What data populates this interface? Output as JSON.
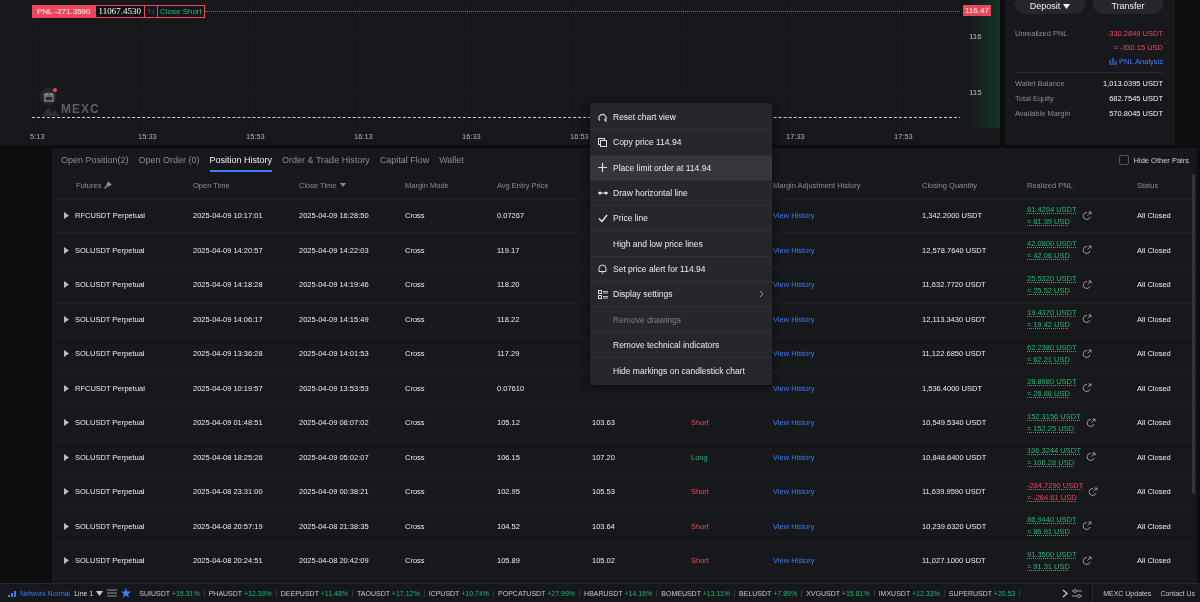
{
  "chart": {
    "position_tag": {
      "pnl": "PNL -271.3590",
      "price": "11067.4530",
      "swap": "↑↓",
      "action": "Close Short"
    },
    "price_tag": "116.47",
    "price_labels": [
      "116",
      "115"
    ],
    "time_labels": [
      "5:13",
      "15:33",
      "15:53",
      "16:13",
      "16:33",
      "16:53",
      "17:33",
      "17:53"
    ],
    "watermark": "MEXC"
  },
  "account": {
    "buttons": [
      {
        "label": "Deposit",
        "dropdown": true
      },
      {
        "label": "Transfer",
        "dropdown": false
      }
    ],
    "unrealized_label": "Unrealized PNL",
    "unrealized_usdt": "-330.2849 USDT",
    "unrealized_usd": "≈ -330.15 USD",
    "pnl_analysis": "PNL Analysis",
    "rows": [
      {
        "label": "Wallet Balance",
        "value": "1,013.0395 USDT"
      },
      {
        "label": "Total Equity",
        "value": "682.7545 USDT"
      },
      {
        "label": "Available Margin",
        "value": "570.8045 USDT"
      }
    ]
  },
  "tabs": [
    {
      "label": "Open Position(2)",
      "selected": false
    },
    {
      "label": "Open Order (0)",
      "selected": false
    },
    {
      "label": "Position History",
      "selected": true
    },
    {
      "label": "Order & Trade History",
      "selected": false
    },
    {
      "label": "Capital Flow",
      "selected": false
    },
    {
      "label": "Wallet",
      "selected": false
    }
  ],
  "hide_other_pairs": {
    "label": "Hide Other Pairs",
    "checked": false
  },
  "table": {
    "columns": [
      {
        "label": "Futures",
        "kind": "pin"
      },
      {
        "label": "Open Time",
        "kind": "plain"
      },
      {
        "label": "Close Time",
        "kind": "sort"
      },
      {
        "label": "Margin Mode",
        "kind": "plain"
      },
      {
        "label": "Avg Entry Price",
        "kind": "plain"
      },
      {
        "label": "Margin Adjustment History",
        "kind": "plain"
      },
      {
        "label": "Closing Quantity",
        "kind": "plain"
      },
      {
        "label": "Realized PNL",
        "kind": "plain"
      },
      {
        "label": "Status",
        "kind": "plain"
      }
    ],
    "rows": [
      {
        "pair": "RFCUSDT Perpetual",
        "open_time": "2025-04-09 10:17:01",
        "close_time": "2025-04-09 16:28:50",
        "margin_mode": "Cross",
        "avg_entry": "0.07267",
        "margin_adjustment": "View History",
        "closing_quantity": "1,342.2000 USDT",
        "pnl": {
          "usdt": "81.4294 USDT",
          "usd": "≈ 81.39 USD",
          "kind": "gain"
        },
        "status": "All Closed"
      },
      {
        "pair": "SOLUSDT Perpetual",
        "open_time": "2025-04-09 14:20:57",
        "close_time": "2025-04-09 14:22:03",
        "margin_mode": "Cross",
        "avg_entry": "119.17",
        "margin_adjustment": "View History",
        "closing_quantity": "12,578.7640 USDT",
        "pnl": {
          "usdt": "42.0800 USDT",
          "usd": "≈ 42.06 USD",
          "kind": "gain"
        },
        "status": "All Closed"
      },
      {
        "pair": "SOLUSDT Perpetual",
        "open_time": "2025-04-09 14:18:28",
        "close_time": "2025-04-09 14:19:46",
        "margin_mode": "Cross",
        "avg_entry": "118.20",
        "margin_adjustment": "View History",
        "closing_quantity": "11,632.7720 USDT",
        "pnl": {
          "usdt": "25.5320 USDT",
          "usd": "≈ 25.52 USD",
          "kind": "gain"
        },
        "status": "All Closed"
      },
      {
        "pair": "SOLUSDT Perpetual",
        "open_time": "2025-04-09 14:06:17",
        "close_time": "2025-04-09 14:15:49",
        "margin_mode": "Cross",
        "avg_entry": "118.22",
        "margin_adjustment": "View History",
        "closing_quantity": "12,113.3430 USDT",
        "pnl": {
          "usdt": "19.4370 USDT",
          "usd": "≈ 19.42 USD",
          "kind": "gain"
        },
        "status": "All Closed"
      },
      {
        "pair": "SOLUSDT Perpetual",
        "open_time": "2025-04-09 13:36:28",
        "close_time": "2025-04-09 14:01:53",
        "margin_mode": "Cross",
        "avg_entry": "117.29",
        "margin_adjustment": "View History",
        "closing_quantity": "11,122.6850 USDT",
        "pnl": {
          "usdt": "62.2380 USDT",
          "usd": "≈ 62.21 USD",
          "kind": "gain"
        },
        "status": "All Closed"
      },
      {
        "pair": "RFCUSDT Perpetual",
        "open_time": "2025-04-09 10:19:57",
        "close_time": "2025-04-09 13:53:53",
        "margin_mode": "Cross",
        "avg_entry": "0.07610",
        "margin_adjustment": "View History",
        "closing_quantity": "1,536.4000 USDT",
        "pnl": {
          "usdt": "28.8980 USDT",
          "usd": "≈ 28.88 USD",
          "kind": "gain"
        },
        "status": "All Closed"
      },
      {
        "pair": "SOLUSDT Perpetual",
        "open_time": "2025-04-09 01:48:51",
        "close_time": "2025-04-09 08:07:02",
        "margin_mode": "Cross",
        "avg_entry": "105.12",
        "avg_close": "103.63",
        "direction": {
          "text": "Short",
          "kind": "short"
        },
        "margin_adjustment": "View History",
        "closing_quantity": "10,549.5340 USDT",
        "pnl": {
          "usdt": "152.3156 USDT",
          "usd": "≈ 152.25 USD",
          "kind": "gain"
        },
        "status": "All Closed"
      },
      {
        "pair": "SOLUSDT Perpetual",
        "open_time": "2025-04-08 18:25:26",
        "close_time": "2025-04-09 05:02:07",
        "margin_mode": "Cross",
        "avg_entry": "106.15",
        "avg_close": "107.20",
        "direction": {
          "text": "Long",
          "kind": "long"
        },
        "margin_adjustment": "View History",
        "closing_quantity": "10,848.6400 USDT",
        "pnl": {
          "usdt": "106.3244 USDT",
          "usd": "≈ 106.28 USD",
          "kind": "gain"
        },
        "status": "All Closed"
      },
      {
        "pair": "SOLUSDT Perpetual",
        "open_time": "2025-04-08 23:31:00",
        "close_time": "2025-04-09 00:38:21",
        "margin_mode": "Cross",
        "avg_entry": "102.95",
        "avg_close": "105.53",
        "direction": {
          "text": "Short",
          "kind": "short"
        },
        "margin_adjustment": "View History",
        "closing_quantity": "11,639.9590 USDT",
        "pnl": {
          "usdt": "-284.7290 USDT",
          "usd": "≈ -284.61 USD",
          "kind": "loss"
        },
        "status": "All Closed"
      },
      {
        "pair": "SOLUSDT Perpetual",
        "open_time": "2025-04-08 20:57:19",
        "close_time": "2025-04-08 21:38:35",
        "margin_mode": "Cross",
        "avg_entry": "104.52",
        "avg_close": "103.64",
        "direction": {
          "text": "Short",
          "kind": "short"
        },
        "margin_adjustment": "View History",
        "closing_quantity": "10,239.6320 USDT",
        "pnl": {
          "usdt": "86.9440 USDT",
          "usd": "≈ 86.91 USD",
          "kind": "gain"
        },
        "status": "All Closed"
      },
      {
        "pair": "SOLUSDT Perpetual",
        "open_time": "2025-04-08 20:24:51",
        "close_time": "2025-04-08 20:42:09",
        "margin_mode": "Cross",
        "avg_entry": "105.89",
        "avg_close": "105.02",
        "direction": {
          "text": "Short",
          "kind": "short"
        },
        "margin_adjustment": "View History",
        "closing_quantity": "11,027.1000 USDT",
        "pnl": {
          "usdt": "91.3500 USDT",
          "usd": "≈ 91.31 USD",
          "kind": "gain"
        },
        "status": "All Closed"
      }
    ]
  },
  "context_menu": [
    {
      "label": "Reset chart view",
      "kind": "reset",
      "checked": false,
      "disabled": false,
      "highlighted": false,
      "submenu": false
    },
    {
      "label": "Copy price 114.94",
      "kind": "copy",
      "checked": false,
      "disabled": false,
      "highlighted": false,
      "submenu": false
    },
    {
      "label": "Place limit order at 114.94",
      "kind": "plus",
      "checked": false,
      "disabled": false,
      "highlighted": true,
      "submenu": false
    },
    {
      "label": "Draw horizontal line",
      "kind": "hline",
      "checked": false,
      "disabled": false,
      "highlighted": false,
      "submenu": false
    },
    {
      "label": "Price line",
      "kind": "plain",
      "checked": true,
      "disabled": false,
      "highlighted": false,
      "submenu": false
    },
    {
      "label": "High and low price lines",
      "kind": "plain",
      "checked": false,
      "disabled": false,
      "highlighted": false,
      "submenu": false
    },
    {
      "label": "Set price alert for 114.94",
      "kind": "bell",
      "checked": false,
      "disabled": false,
      "highlighted": false,
      "submenu": false
    },
    {
      "label": "Display settings",
      "kind": "settings",
      "checked": false,
      "disabled": false,
      "highlighted": false,
      "submenu": true
    },
    {
      "label": "Remove drawings",
      "kind": "plain",
      "checked": false,
      "disabled": true,
      "highlighted": false,
      "submenu": false
    },
    {
      "label": "Remove technical indicators",
      "kind": "plain",
      "checked": false,
      "disabled": false,
      "highlighted": false,
      "submenu": false
    },
    {
      "label": "Hide markings on candlestick chart",
      "kind": "plain",
      "checked": false,
      "disabled": false,
      "highlighted": false,
      "submenu": false
    }
  ],
  "status_bar": {
    "network": "Network Normal",
    "line": "Line 1",
    "tickers": [
      {
        "symbol": "SUIUSDT",
        "change": "+15.31%"
      },
      {
        "symbol": "PHAUSDT",
        "change": "+12.39%"
      },
      {
        "symbol": "DEEPUSDT",
        "change": "+11.48%"
      },
      {
        "symbol": "TAOUSDT",
        "change": "+17.12%"
      },
      {
        "symbol": "ICPUSDT",
        "change": "+10.74%"
      },
      {
        "symbol": "POPCATUSDT",
        "change": "+27.99%"
      },
      {
        "symbol": "HBARUSDT",
        "change": "+14.16%"
      },
      {
        "symbol": "BOMEUSDT",
        "change": "+13.11%"
      },
      {
        "symbol": "BELUSDT",
        "change": "+7.89%"
      },
      {
        "symbol": "XVGUSDT",
        "change": "+15.81%"
      },
      {
        "symbol": "IMXUSDT",
        "change": "+12.33%"
      },
      {
        "symbol": "SUPERUSDT",
        "change": "+20.53"
      }
    ],
    "links": [
      "MEXC Updates",
      "Contact Us"
    ]
  }
}
